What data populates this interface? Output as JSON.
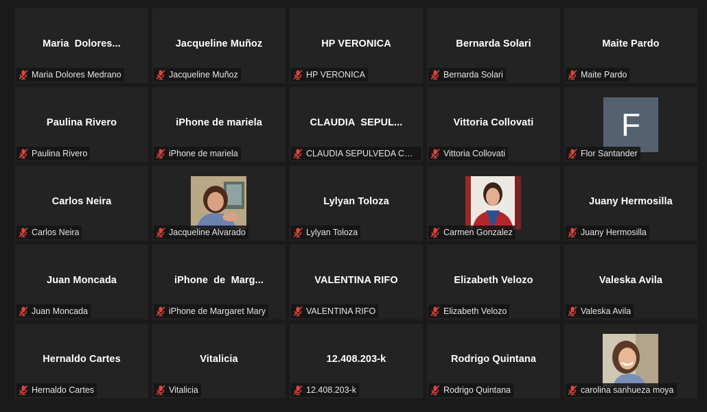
{
  "colors": {
    "background": "#1a1a1a",
    "tile": "#232323",
    "mic_muted": "#e0443a",
    "avatar_f": "#546170"
  },
  "participants": [
    {
      "title": "Maria  Dolores...",
      "name": "Maria Dolores Medrano"
    },
    {
      "title": "Jacqueline Muñoz",
      "name": "Jacqueline Muñoz"
    },
    {
      "title": "HP VERONICA",
      "name": "HP VERONICA"
    },
    {
      "title": "Bernarda Solari",
      "name": "Bernarda Solari"
    },
    {
      "title": "Maite Pardo",
      "name": "Maite Pardo"
    },
    {
      "title": "Paulina Rivero",
      "name": "Paulina Rivero"
    },
    {
      "title": "iPhone de mariela",
      "name": "iPhone de mariela"
    },
    {
      "title": "CLAUDIA  SEPUL...",
      "name": "CLAUDIA SEPULVEDA CON..."
    },
    {
      "title": "Vittoria Collovati",
      "name": "Vittoria Collovati"
    },
    {
      "avatar_letter": "F",
      "name": "Flor Santander"
    },
    {
      "title": "Carlos Neira",
      "name": "Carlos Neira"
    },
    {
      "avatar_image": "woman-portrait-photo",
      "name": "Jacqueline Alvarado"
    },
    {
      "title": "Lylyan Toloza",
      "name": "Lylyan Toloza"
    },
    {
      "avatar_image": "spiderman-portrait-photo",
      "name": "Carmen Gonzalez"
    },
    {
      "title": "Juany Hermosilla",
      "name": "Juany Hermosilla"
    },
    {
      "title": "Juan Moncada",
      "name": "Juan Moncada"
    },
    {
      "title": "iPhone  de  Marg...",
      "name": "iPhone de Margaret Mary"
    },
    {
      "title": "VALENTINA RIFO",
      "name": "VALENTINA RIFO"
    },
    {
      "title": "Elizabeth Velozo",
      "name": "Elizabeth Velozo"
    },
    {
      "title": "Valeska Avila",
      "name": "Valeska Avila"
    },
    {
      "title": "Hernaldo Cartes",
      "name": "Hernaldo Cartes"
    },
    {
      "title": "Vitalicia",
      "name": "Vitalicia"
    },
    {
      "title": "12.408.203-k",
      "name": "12.408.203-k"
    },
    {
      "title": "Rodrigo Quintana",
      "name": "Rodrigo Quintana"
    },
    {
      "avatar_image": "smiling-woman-portrait-photo",
      "name": "carolina sanhueza moya"
    }
  ]
}
